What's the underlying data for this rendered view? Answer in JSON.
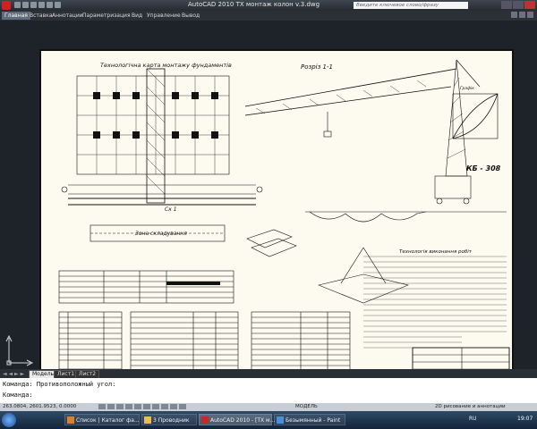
{
  "window": {
    "title": "AutoCAD 2010   TX монтаж колон v.3.dwg",
    "search_placeholder": "Введите ключевое слово/фразу"
  },
  "ribbon": {
    "tabs": [
      "Главная",
      "Вставка",
      "Аннотации",
      "Параметризация",
      "Вид",
      "Управление",
      "Вывод"
    ],
    "active_tab": "Главная"
  },
  "drawing": {
    "plan_title": "Технологічна карта монтажу фундаментів",
    "section_title": "Розріз 1-1",
    "crane_label": "КБ - 308",
    "axis_label": "Ск 1",
    "storage_zone": "Зона складування",
    "notes_title": "Технологія виконання робіт",
    "chart_title": "Графік"
  },
  "layout_tabs": [
    "Модель",
    "Лист1",
    "Лист2"
  ],
  "active_layout": "Модель",
  "command": {
    "history": "Команда: Противоположный угол:",
    "prompt": "Команда:"
  },
  "status": {
    "coords": "263.0804, 2601.9523, 0.0000",
    "model": "МОДЕЛЬ",
    "workspace": "2D рисование и аннотации"
  },
  "taskbar": {
    "items": [
      {
        "label": "Список | Каталог фа...",
        "color": "#d9822b"
      },
      {
        "label": "3 Проводник",
        "color": "#e6c04a"
      },
      {
        "label": "AutoCAD 2010 - [TX м...",
        "color": "#c62828"
      },
      {
        "label": "Безымянный - Paint",
        "color": "#4a8fd9"
      }
    ],
    "tray": "RU",
    "clock": "19:07"
  }
}
